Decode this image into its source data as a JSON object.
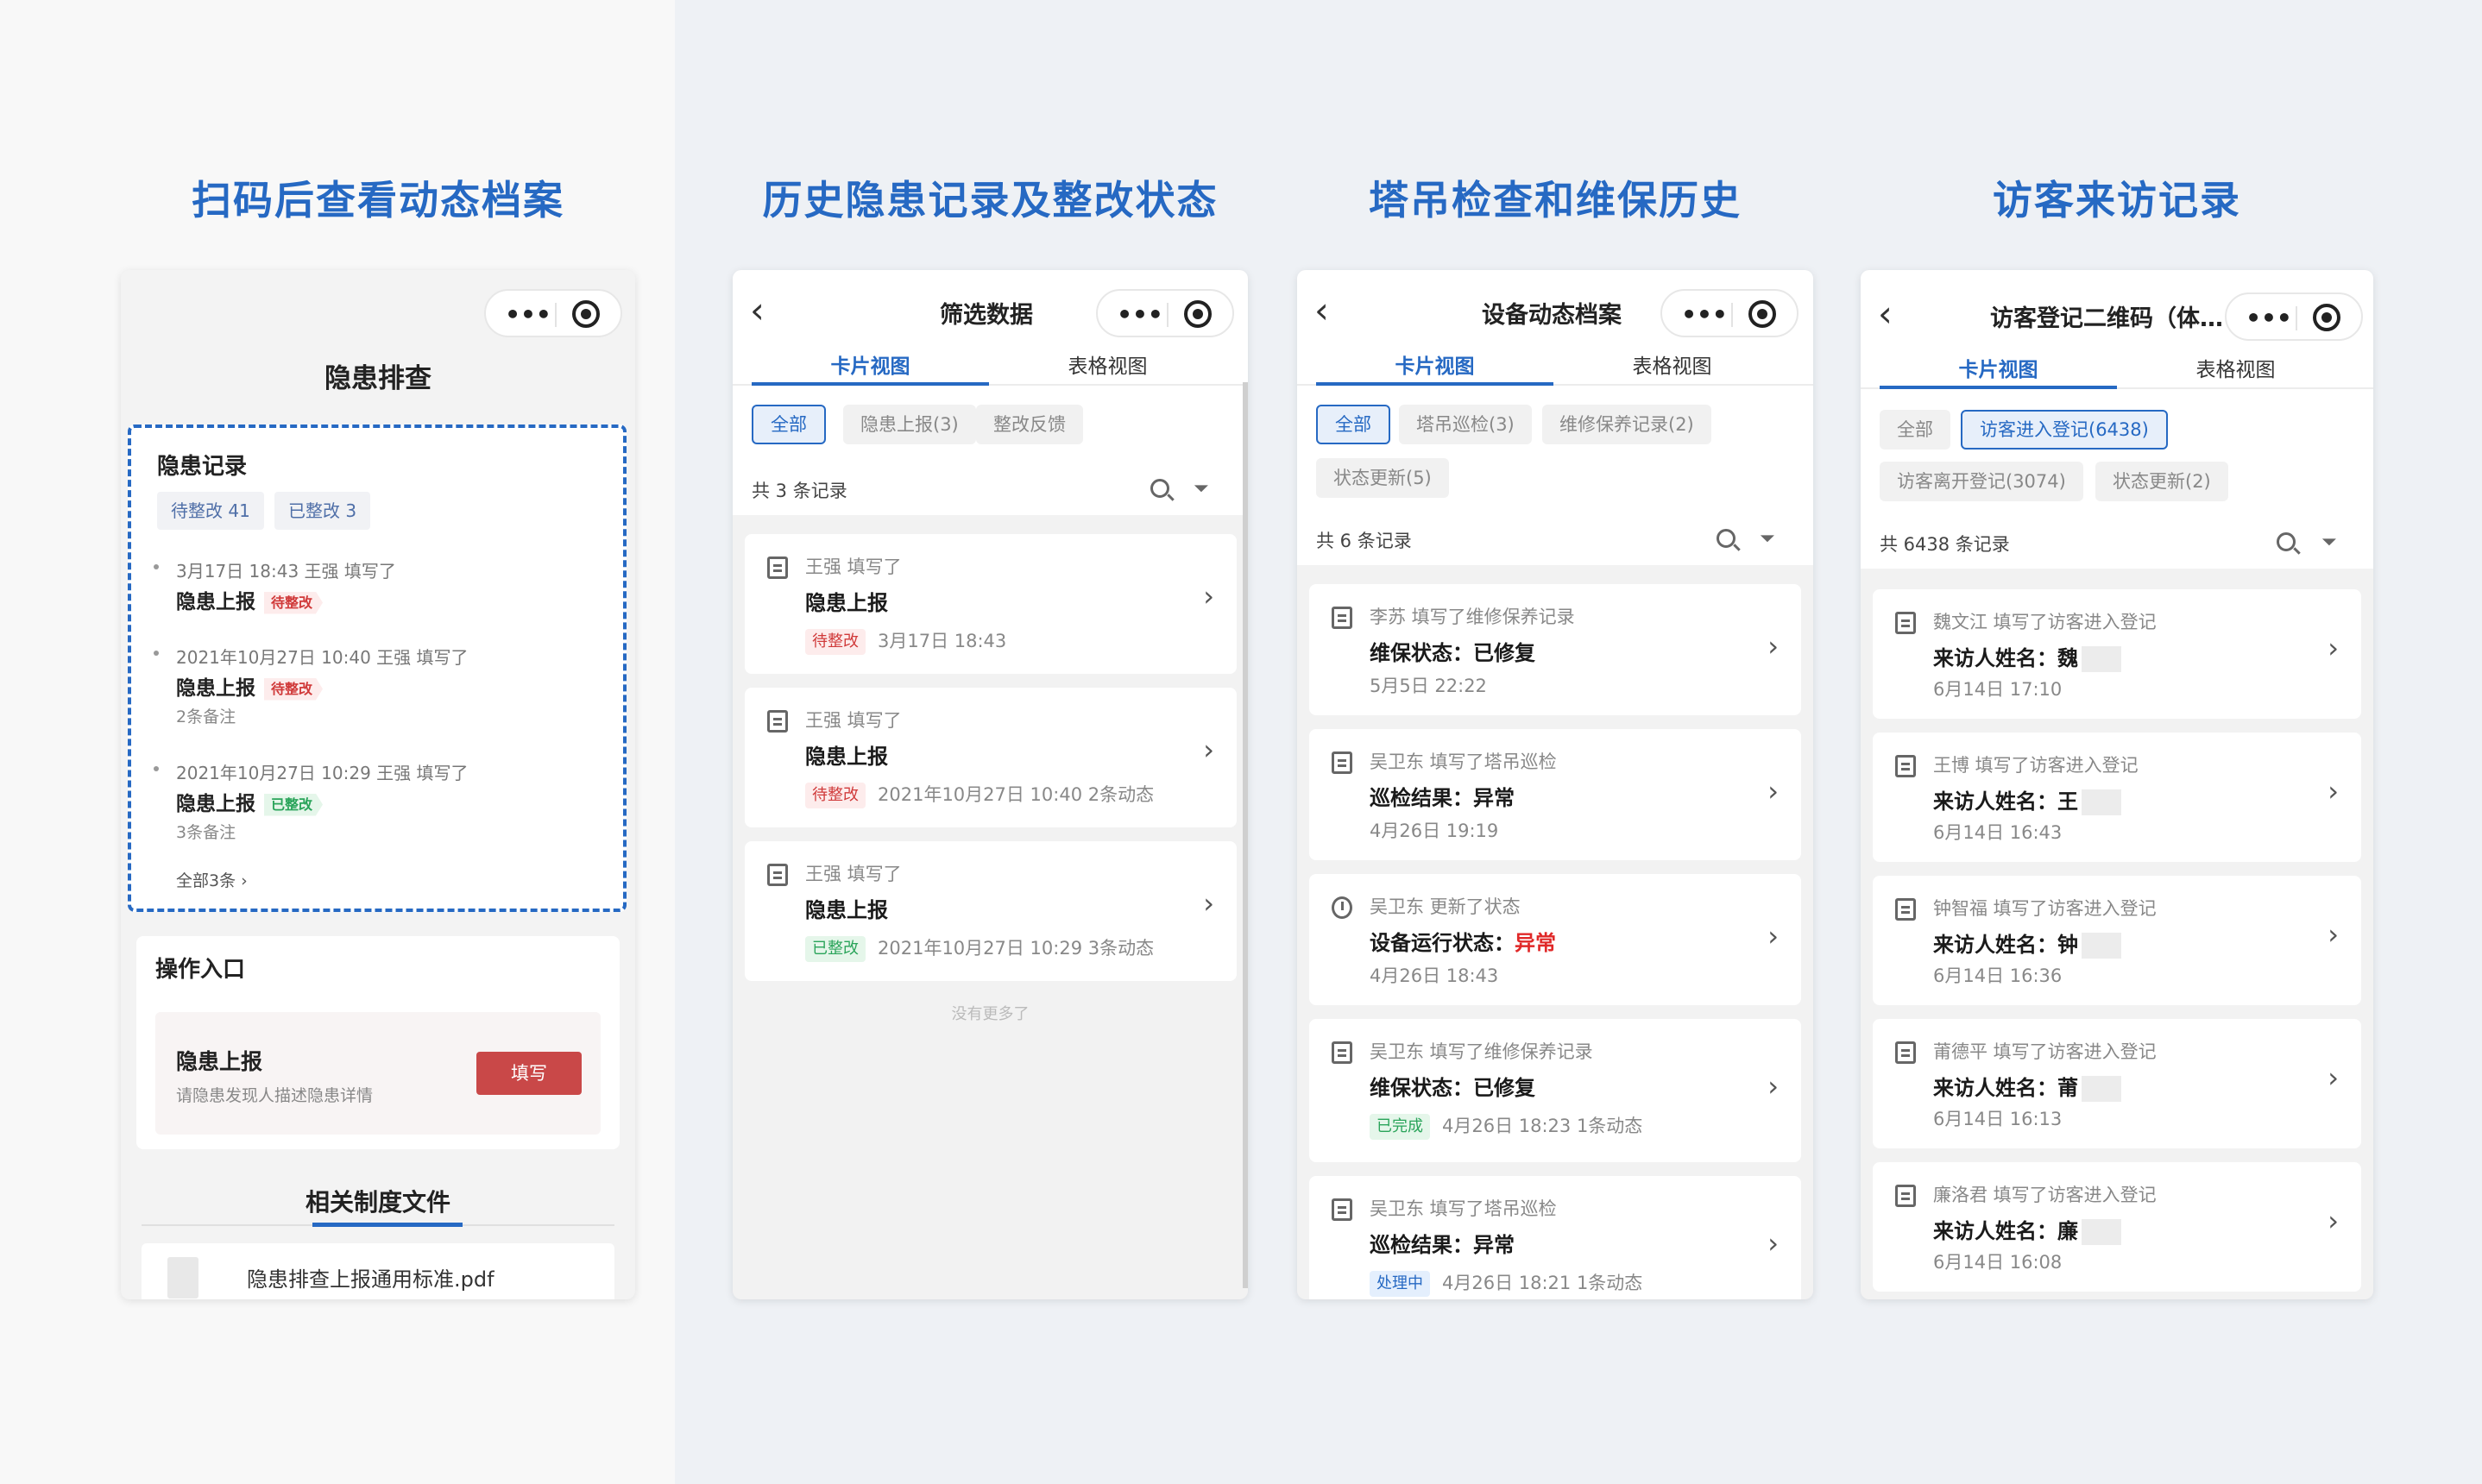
{
  "headings": [
    "扫码后查看动态档案",
    "历史隐患记录及整改状态",
    "塔吊检查和维保历史",
    "访客来访记录"
  ],
  "phone1": {
    "title": "隐患排查",
    "records_header": "隐患记录",
    "stats": [
      "待整改 41",
      "已整改 3"
    ],
    "timeline": [
      {
        "meta": "3月17日 18:43  王强 填写了",
        "main": "隐患上报",
        "flag": "待整改",
        "note": ""
      },
      {
        "meta": "2021年10月27日 10:40  王强 填写了",
        "main": "隐患上报",
        "flag": "待整改",
        "note": "2条备注"
      },
      {
        "meta": "2021年10月27日 10:29  王强 填写了",
        "main": "隐患上报",
        "flag": "已整改",
        "note": "3条备注"
      }
    ],
    "all_link": "全部3条 ›",
    "op_header": "操作入口",
    "op_name": "隐患上报",
    "op_desc": "请隐患发现人描述隐患详情",
    "op_button": "填写",
    "docs_header": "相关制度文件",
    "doc_file": "隐患排查上报通用标准.pdf"
  },
  "phone2": {
    "nav_title": "筛选数据",
    "tabs": [
      "卡片视图",
      "表格视图"
    ],
    "chips": [
      "全部",
      "隐患上报(3)",
      "整改反馈"
    ],
    "count": "共 3 条记录",
    "cards": [
      {
        "who": "王强 填写了",
        "main": "隐患上报",
        "tag": "待整改",
        "sub": "3月17日 18:43"
      },
      {
        "who": "王强 填写了",
        "main": "隐患上报",
        "tag": "待整改",
        "sub": "2021年10月27日 10:40  2条动态"
      },
      {
        "who": "王强 填写了",
        "main": "隐患上报",
        "tag": "已整改",
        "sub": "2021年10月27日 10:29  3条动态"
      }
    ],
    "nomore": "没有更多了"
  },
  "phone3": {
    "nav_title": "设备动态档案",
    "tabs": [
      "卡片视图",
      "表格视图"
    ],
    "chips": [
      "全部",
      "塔吊巡检(3)",
      "维修保养记录(2)",
      "状态更新(5)"
    ],
    "count": "共 6 条记录",
    "cards": [
      {
        "who": "李苏 填写了维修保养记录",
        "main": "维保状态：已修复",
        "sub": "5月5日 22:22"
      },
      {
        "who": "吴卫东 填写了塔吊巡检",
        "main": "巡检结果：异常",
        "sub": "4月26日 19:19"
      },
      {
        "who": "吴卫东 更新了状态",
        "main": "设备运行状态：",
        "main_red": "异常",
        "sub": "4月26日 18:43"
      },
      {
        "who": "吴卫东 填写了维修保养记录",
        "main": "维保状态：已修复",
        "tag": "已完成",
        "sub": "4月26日 18:23  1条动态"
      },
      {
        "who": "吴卫东 填写了塔吊巡检",
        "main": "巡检结果：异常",
        "tag": "处理中",
        "sub": "4月26日 18:21  1条动态"
      }
    ]
  },
  "phone4": {
    "nav_title": "访客登记二维码（体…",
    "tabs": [
      "卡片视图",
      "表格视图"
    ],
    "chips": [
      "全部",
      "访客进入登记(6438)",
      "访客离开登记(3074)",
      "状态更新(2)"
    ],
    "count": "共 6438 条记录",
    "cards": [
      {
        "who": "魏文江 填写了访客进入登记",
        "main": "来访人姓名：魏",
        "sub": "6月14日 17:10"
      },
      {
        "who": "王博 填写了访客进入登记",
        "main": "来访人姓名：王",
        "sub": "6月14日 16:43"
      },
      {
        "who": "钟智福 填写了访客进入登记",
        "main": "来访人姓名：钟",
        "sub": "6月14日 16:36"
      },
      {
        "who": "莆德平 填写了访客进入登记",
        "main": "来访人姓名：莆",
        "sub": "6月14日 16:13"
      },
      {
        "who": "廉洛君 填写了访客进入登记",
        "main": "来访人姓名：廉",
        "sub": "6月14日 16:08"
      }
    ]
  },
  "icons": {
    "capsule_menu": "more-dots-icon",
    "capsule_close": "record-circle-icon",
    "back": "chevron-left-icon",
    "search": "search-icon",
    "filter": "filter-icon",
    "record": "edit-note-icon",
    "arrow": "chevron-right-icon"
  },
  "colors": {
    "accent": "#2669c3",
    "danger": "#c94848",
    "pending_text": "#d03a3a",
    "done_text": "#2aa45a"
  }
}
